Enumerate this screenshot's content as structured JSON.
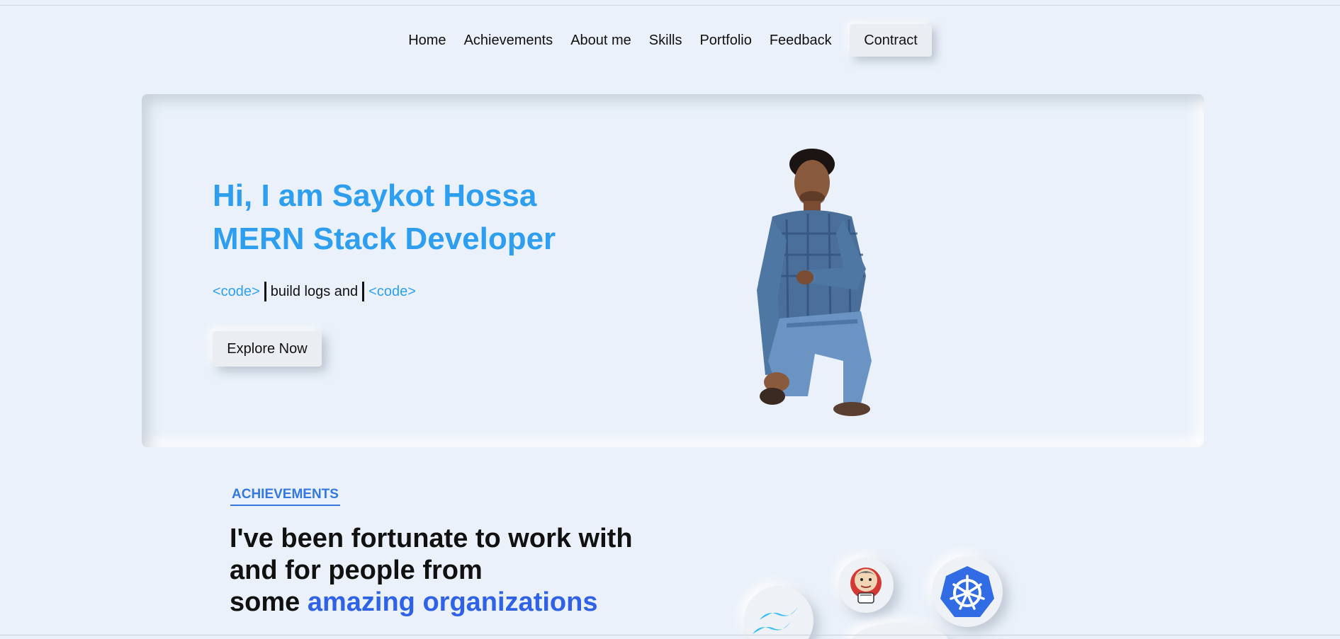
{
  "nav": {
    "items": [
      "Home",
      "Achievements",
      "About me",
      "Skills",
      "Portfolio",
      "Feedback"
    ],
    "button_label": "Contract"
  },
  "hero": {
    "greeting": "Hi, I am Saykot Hossa",
    "role": "MERN Stack Developer",
    "code_open": "<code>",
    "typed_text": "build logs and",
    "code_close": "<code>",
    "cta_label": "Explore Now"
  },
  "achievements": {
    "label": "ACHIEVEMENTS",
    "heading_line1": "I've been fortunate to work with",
    "heading_line2": "and for people from",
    "heading_line3_prefix": "some",
    "heading_highlight": "amazing organizations"
  },
  "icons": [
    "tailwind-icon",
    "jenkins-icon",
    "kubernetes-icon"
  ],
  "colors": {
    "background": "#eaf1fa",
    "accent": "#2e9ff0",
    "highlight": "#2f62e6",
    "label": "#3478e0"
  }
}
